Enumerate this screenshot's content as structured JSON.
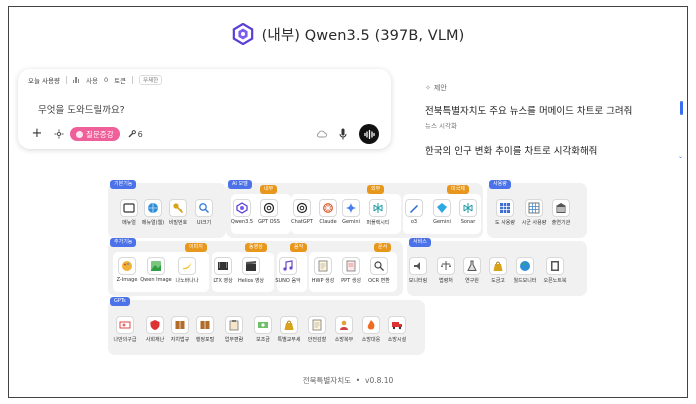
{
  "header": {
    "title": "(내부) Qwen3.5 (397B, VLM)",
    "logo_icon": "qwen-logo-icon"
  },
  "chat": {
    "usage_label": "오늘 사용량",
    "usage_icon": "bar-chart-icon",
    "usage_prefix": "사용",
    "usage_value": "0",
    "usage_unit": "토큰",
    "usage_badge": "무제한",
    "prompt_placeholder": "무엇을 도와드릴까요?",
    "question_button": "질문증강",
    "tool_count": "6"
  },
  "suggestions": {
    "header": "제안",
    "items": [
      {
        "title": "전북특별자치도 주요 뉴스를 머메이드 차트로 그려줘",
        "sub": "뉴스 시각화"
      },
      {
        "title": "한국의 인구 변화 추이를 차트로 시각화해줘",
        "sub": ""
      }
    ]
  },
  "groups": {
    "basic": {
      "title": "기본기능",
      "items": [
        "메뉴얼",
        "메뉴얼(웹)",
        "비밀번호",
        "UI크기"
      ]
    },
    "ai": {
      "title": "AI 모델",
      "internal_tag": "내부",
      "external_tag": "외부",
      "overseas_tag": "미국제",
      "items": [
        "Qwen3.5",
        "GPT OSS",
        "ChatGPT",
        "Claude",
        "Gemini",
        "퍼플렉시티",
        "o3",
        "Gemini",
        "Sonar"
      ]
    },
    "usage": {
      "title": "사용량",
      "items": [
        "도 사용량",
        "시군 사용량",
        "출연기관"
      ]
    },
    "extra": {
      "title": "추가기능",
      "image_tag": "이미지",
      "video_tag": "동영상",
      "music_tag": "음악",
      "doc_tag": "문서",
      "items": [
        "Z-Image",
        "Qwen Image",
        "나노바나나",
        "LTX 영상",
        "Helios 영상",
        "SUNO 음악",
        "HWP 생성",
        "PPT 생성",
        "OCR 변환"
      ]
    },
    "service": {
      "title": "서비스",
      "items": [
        "모니터링",
        "법령처",
        "연구원",
        "도금고",
        "월드모니터",
        "오픈노트북"
      ]
    },
    "gpts": {
      "title": "GPTs",
      "items": [
        "나만의구급",
        "사회재난",
        "자치법규",
        "행정포털",
        "업무편람",
        "보조금",
        "특별교부세",
        "안전감찰",
        "소방복무",
        "소방대응",
        "소방시설"
      ]
    }
  },
  "footer": {
    "org": "전북특별자치도",
    "version": "v0.8.10"
  }
}
